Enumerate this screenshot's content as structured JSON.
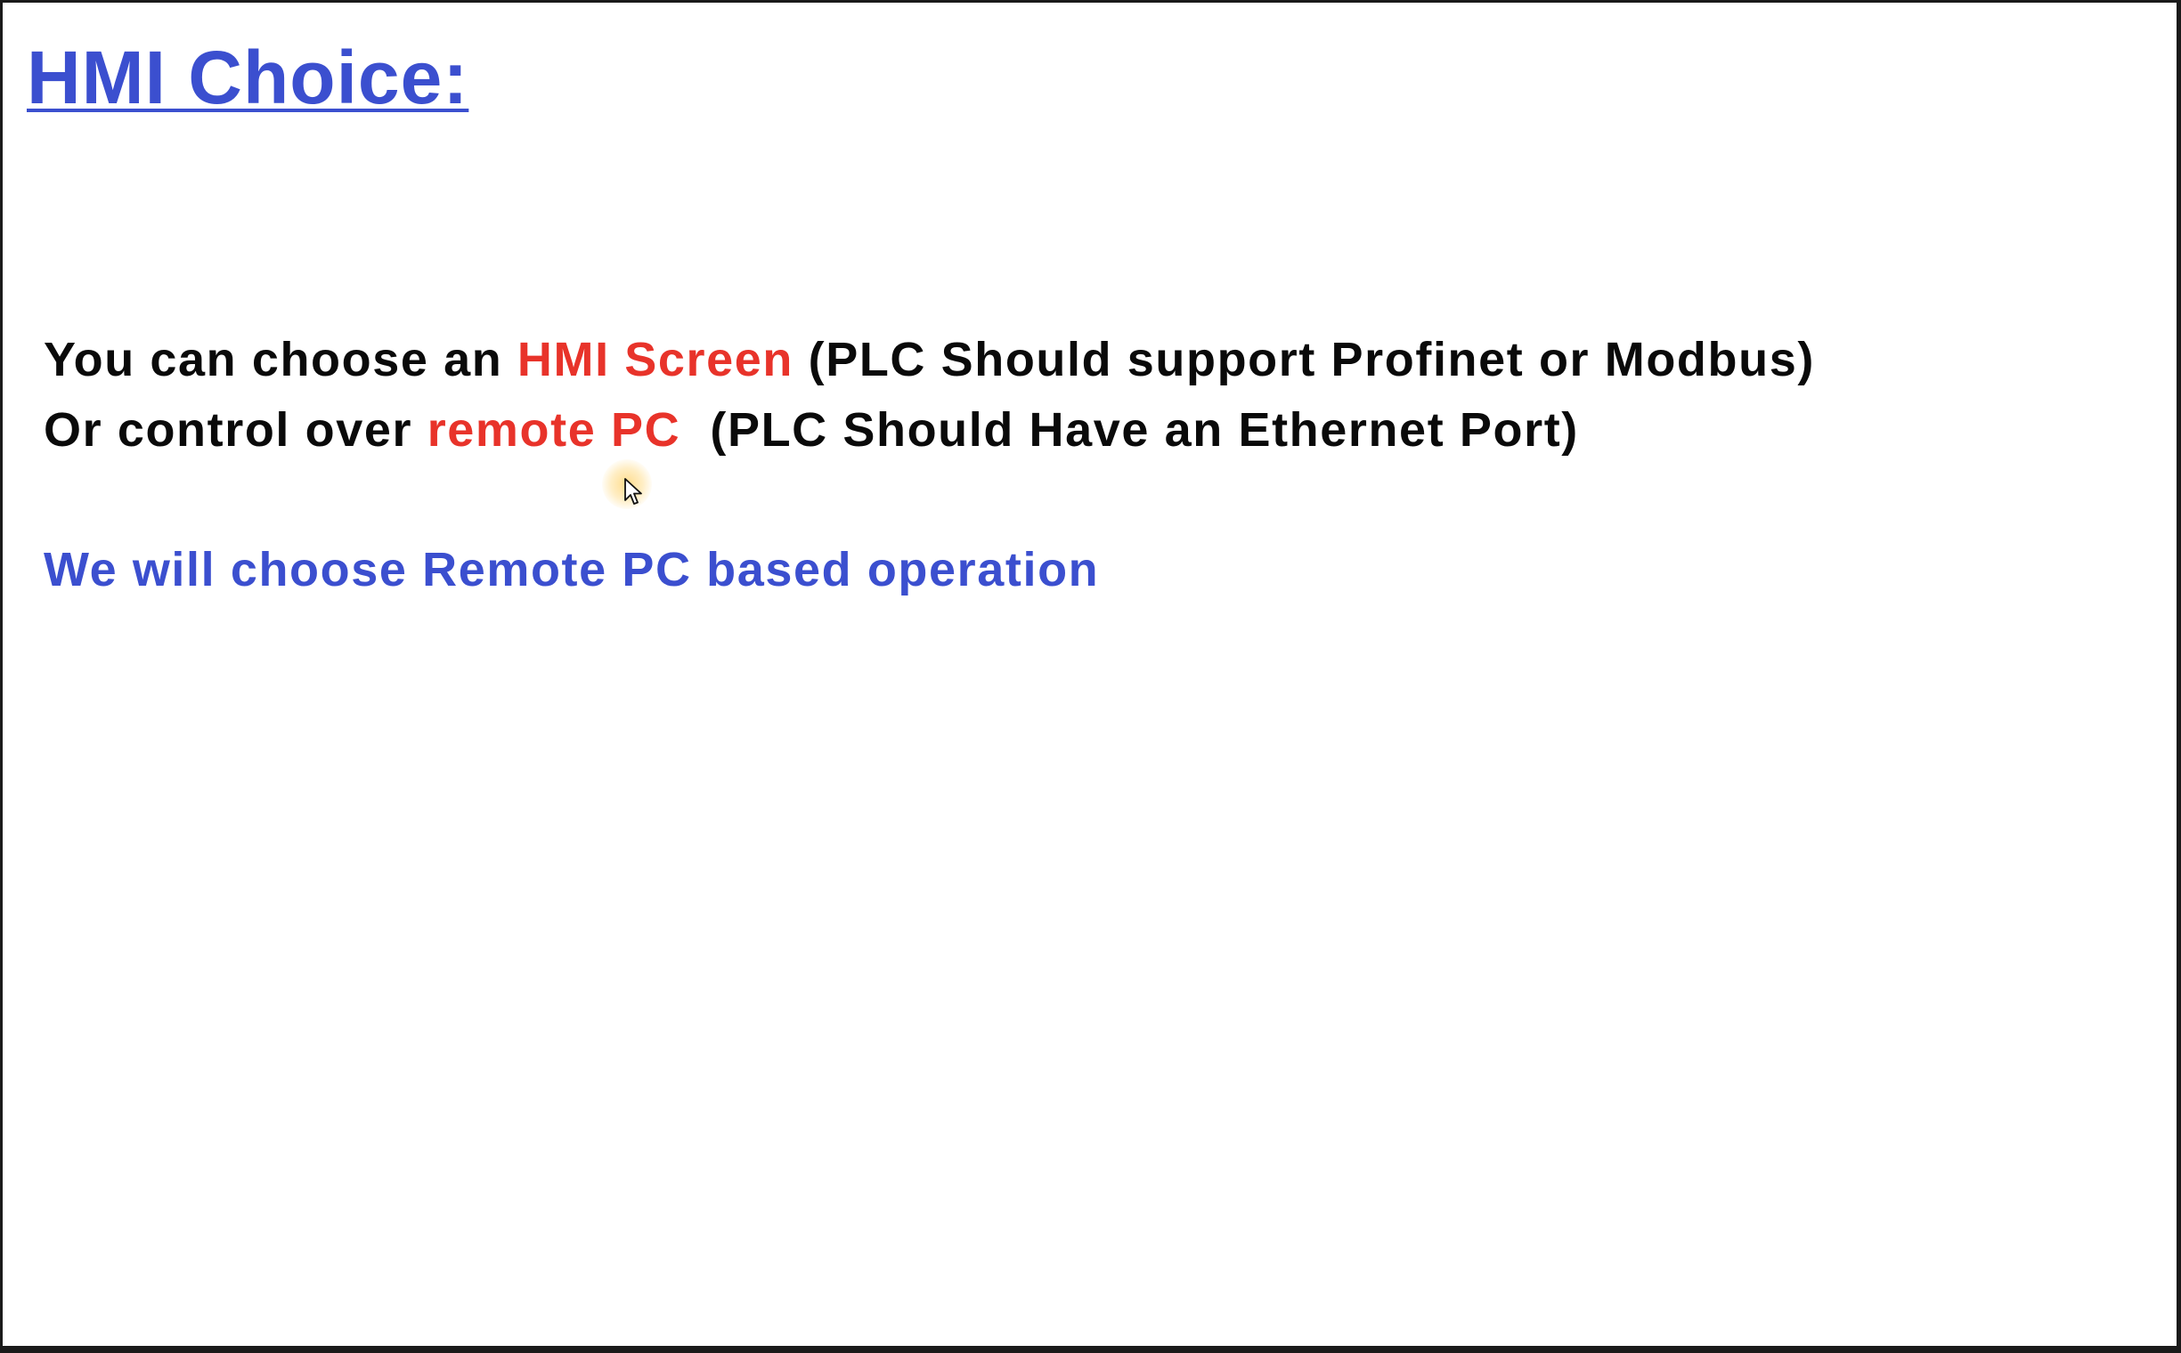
{
  "slide": {
    "title": "HMI Choice:",
    "line1": {
      "before": "You can choose an ",
      "highlight": "HMI Screen",
      "after": " (PLC Should support Profinet or Modbus)"
    },
    "line2": {
      "before": "Or control over ",
      "highlight": "remote PC",
      "after": "  (PLC Should Have an Ethernet Port)"
    },
    "conclusion": "We will choose Remote PC based operation"
  },
  "colors": {
    "title": "#3b4fcf",
    "body_text": "#0a0a0a",
    "highlight": "#e8332a",
    "conclusion": "#3b4fcf",
    "background": "#ffffff"
  },
  "icons": {
    "cursor": "mouse-pointer-icon"
  }
}
